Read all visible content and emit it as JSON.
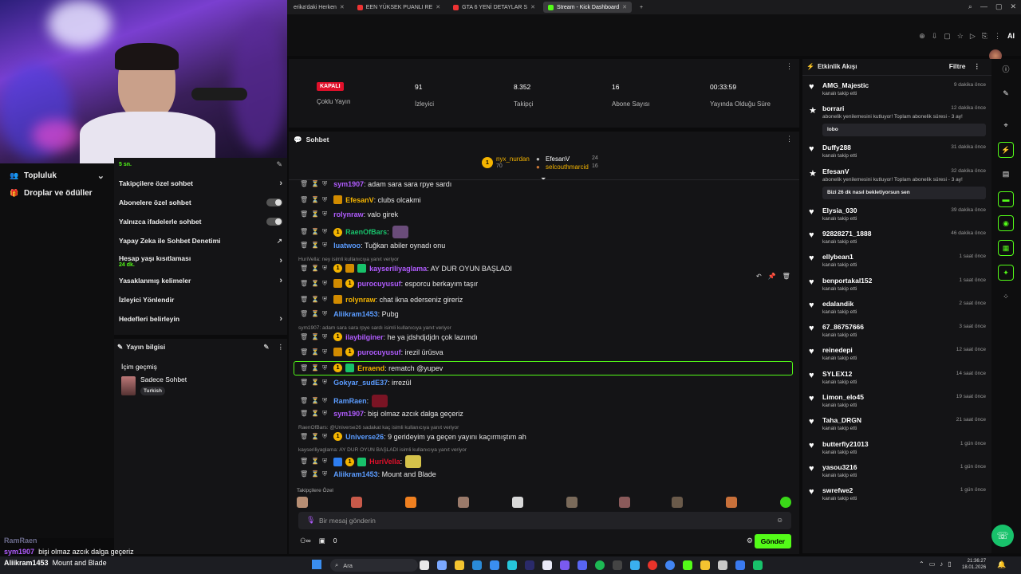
{
  "browser": {
    "tabs": [
      {
        "label": "erika'daki Herken"
      },
      {
        "label": "EEN YÜKSEK PUANLI RE"
      },
      {
        "label": "GTA 6 YENİ DETAYLAR S"
      },
      {
        "label": "Stream - Kick Dashboard",
        "active": true
      }
    ],
    "ai_label": "AI"
  },
  "leftnav": {
    "community": "Topluluk",
    "drops": "Droplar ve ödüller"
  },
  "settings": {
    "timer_text": "5 sn.",
    "rows": [
      {
        "label": "Takipçilere özel sohbet",
        "control": "chevron"
      },
      {
        "label": "Abonelere özel sohbet",
        "control": "toggle"
      },
      {
        "label": "Yalnızca ifadelerle sohbet",
        "control": "toggle"
      },
      {
        "label": "Yapay Zeka ile Sohbet Denetimi",
        "control": "external"
      },
      {
        "label": "Hesap yaşı kısıtlaması",
        "sub": "24 dk.",
        "control": "chevron"
      },
      {
        "label": "Yasaklanmış kelimeler",
        "control": "chevron"
      },
      {
        "label": "İzleyici Yönlendir",
        "control": "none"
      },
      {
        "label": "Hedefleri belirleyin",
        "control": "chevron"
      }
    ]
  },
  "stream_info": {
    "title": "Yayın bilgisi",
    "history": "İçim geçmiş",
    "category": "Sadece Sohbet",
    "language": "Turkish"
  },
  "stats": {
    "status_badge": "KAPALI",
    "multi_stream": "Çoklu Yayın",
    "viewers_value": "91",
    "viewers_label": "İzleyici",
    "followers_value": "8.352",
    "followers_label": "Takipçi",
    "subs_value": "16",
    "subs_label": "Abone Sayısı",
    "uptime_value": "00:33:59",
    "uptime_label": "Yayında Olduğu Süre"
  },
  "chat": {
    "title": "Sohbet",
    "leaderboard": {
      "first_name": "nyx_nurdan",
      "first_value": "70",
      "second_name": "EfesanV",
      "second_value": "24",
      "third_name": "selcouthmarcid",
      "third_value": "16"
    },
    "messages": [
      {
        "user": "sym1907",
        "color": "#b15cff",
        "text": ": adam sara sara rpye sardı",
        "badges": []
      },
      {
        "user": "EfesanV",
        "color": "#f4b400",
        "text": ": clubs olcakmi",
        "badges": [
          "crown"
        ]
      },
      {
        "user": "rolynraw",
        "color": "#b15cff",
        "text": ": valo girek",
        "badges": []
      },
      {
        "user": "RaenOfBars",
        "color": "#18c26b",
        "text": ":",
        "badges": [
          "gold"
        ],
        "emote": "#6a4c7a"
      },
      {
        "user": "luatwoo",
        "color": "#5b9cff",
        "text": ": Tuğkan abiler oynadı onu",
        "badges": []
      },
      {
        "user": "kayseriliyaglama",
        "color": "#b15cff",
        "text": ": AY DUR OYUN BAŞLADI",
        "badges": [
          "gold",
          "crown",
          "gift"
        ]
      },
      {
        "user": "purocuyusuf",
        "color": "#b15cff",
        "text": ": esporcu berkayım taşır",
        "badges": [
          "crown",
          "gold"
        ]
      },
      {
        "user": "rolynraw",
        "color": "#f4b400",
        "text": ": chat ikna ederseniz gireriz",
        "badges": [
          "crown"
        ]
      },
      {
        "user": "Aliikram1453",
        "color": "#5b9cff",
        "text": ": Pubg",
        "badges": []
      },
      {
        "user": "ilaybilginer",
        "color": "#b15cff",
        "text": ": he ya jdshdjdjdn çok lazımdı",
        "badges": [
          "gold"
        ]
      },
      {
        "user": "purocuyusuf",
        "color": "#b15cff",
        "text": ": irezil ürüsva",
        "badges": [
          "crown",
          "gold"
        ]
      },
      {
        "user": "Erraend",
        "color": "#f4b400",
        "text": ": rematch @yupev",
        "badges": [
          "gold",
          "gift"
        ]
      },
      {
        "user": "Gokyar_sudE37",
        "color": "#5b9cff",
        "text": ": irrezül",
        "badges": []
      },
      {
        "user": "RamRaen",
        "color": "#5b9cff",
        "text": ":",
        "badges": [],
        "emote": "#7a1424"
      },
      {
        "user": "sym1907",
        "color": "#b15cff",
        "text": ": bişi olmaz azcık dalga geçeriz",
        "badges": []
      },
      {
        "user": "Universe26",
        "color": "#5b9cff",
        "text": ": 9 gerideyim ya geçen yayını kaçırmıştım ah",
        "badges": [
          "gold"
        ]
      },
      {
        "user": "HuriVella",
        "color": "#e0102a",
        "text": ":",
        "badges": [
          "blue",
          "gold",
          "gift"
        ],
        "emote": "#d4c24a"
      },
      {
        "user": "Aliikram1453",
        "color": "#5b9cff",
        "text": ": Mount and Blade",
        "badges": []
      }
    ],
    "replies": [
      "HuriVella: ney isimli kullanıcıya yanıt veriyor",
      "sym1907: adam sara sara rpye sardı isimli kullanıcıya yanıt veriyor",
      "RaenOfBars: @Universe26 sadakat kaç isimli kullanıcıya yanıt veriyor",
      "kayseriliyaglama: AY DUR OYUN BAŞLADI isimli kullanıcıya yanıt veriyor"
    ],
    "followers_only_label": "Takipçilere Özel",
    "input_placeholder": "Bir mesaj gönderin",
    "send_label": "Gönder",
    "points_label": "0"
  },
  "feed": {
    "title": "Etkinlik Akışı",
    "filter_label": "Filtre",
    "items": [
      {
        "name": "AMG_Majestic",
        "action": "kanalı takip etti",
        "time": "9 dakika önce",
        "icon": "heart"
      },
      {
        "name": "borrari",
        "action": "abonelik yenilemesini kutluyor! Toplam abonelik süresi - 3 ay!",
        "time": "12 dakika önce",
        "icon": "star",
        "message": "lobo"
      },
      {
        "name": "Duffy288",
        "action": "kanalı takip etti",
        "time": "31 dakika önce",
        "icon": "heart"
      },
      {
        "name": "EfesanV",
        "action": "abonelik yenilemesini kutluyor! Toplam abonelik süresi - 3 ay!",
        "time": "32 dakika önce",
        "icon": "star",
        "message": "Bizi 26 dk nasıl bekletiyorsun sen"
      },
      {
        "name": "Elysia_030",
        "action": "kanalı takip etti",
        "time": "39 dakika önce",
        "icon": "heart"
      },
      {
        "name": "92828271_1888",
        "action": "kanalı takip etti",
        "time": "46 dakika önce",
        "icon": "heart"
      },
      {
        "name": "ellybean1",
        "action": "kanalı takip etti",
        "time": "1 saat önce",
        "icon": "heart"
      },
      {
        "name": "benportakal152",
        "action": "kanalı takip etti",
        "time": "1 saat önce",
        "icon": "heart"
      },
      {
        "name": "edalandik",
        "action": "kanalı takip etti",
        "time": "2 saat önce",
        "icon": "heart"
      },
      {
        "name": "67_86757666",
        "action": "kanalı takip etti",
        "time": "3 saat önce",
        "icon": "heart"
      },
      {
        "name": "reinedepi",
        "action": "kanalı takip etti",
        "time": "12 saat önce",
        "icon": "heart"
      },
      {
        "name": "SYLEX12",
        "action": "kanalı takip etti",
        "time": "14 saat önce",
        "icon": "heart"
      },
      {
        "name": "Limon_elo45",
        "action": "kanalı takip etti",
        "time": "19 saat önce",
        "icon": "heart"
      },
      {
        "name": "Taha_DRGN",
        "action": "kanalı takip etti",
        "time": "21 saat önce",
        "icon": "heart"
      },
      {
        "name": "butterfly21013",
        "action": "kanalı takip etti",
        "time": "1 gün önce",
        "icon": "heart"
      },
      {
        "name": "yasou3216",
        "action": "kanalı takip etti",
        "time": "1 gün önce",
        "icon": "heart"
      },
      {
        "name": "swrefwe2",
        "action": "kanalı takip etti",
        "time": "1 gün önce",
        "icon": "heart"
      }
    ]
  },
  "overlay": {
    "line1_user": "RamRaen",
    "line2_user": "sym1907",
    "line2_text": "bişi olmaz azcık dalga geçeriz",
    "line3_user": "Aliikram1453",
    "line3_text": "Mount and Blade"
  },
  "taskbar": {
    "search_label": "Ara",
    "time": "21:36:27",
    "date": "18.01.2026"
  },
  "colors": {
    "accent": "#53fc18",
    "panel": "#141416",
    "live_red": "#e0102a"
  }
}
